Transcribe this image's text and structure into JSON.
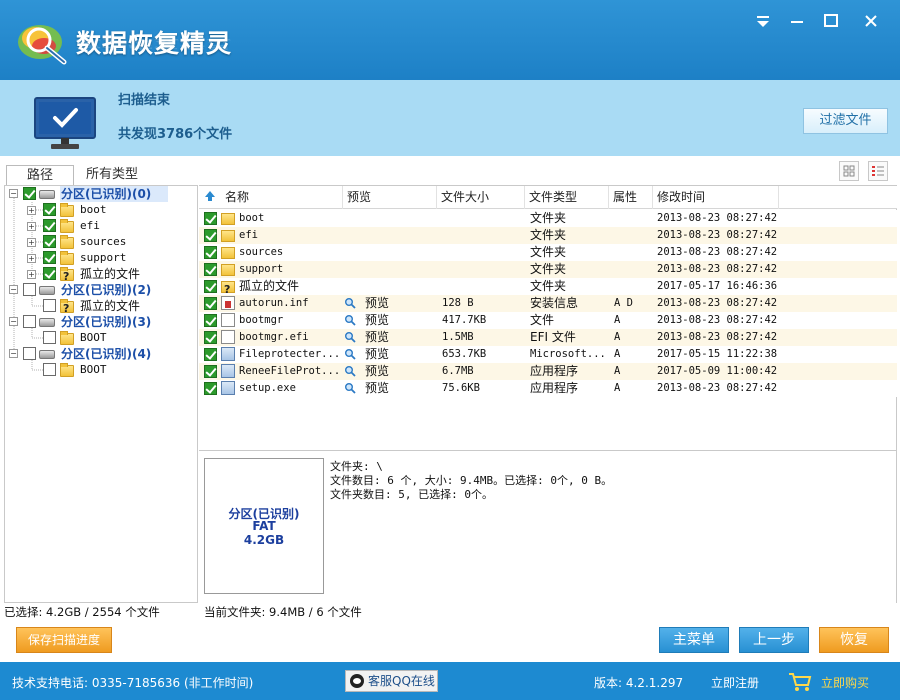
{
  "app": {
    "title": "数据恢复精灵"
  },
  "window_controls": {
    "menu": "▾",
    "minimize": "—",
    "maximize": "□",
    "close": "✕"
  },
  "scan": {
    "title": "扫描结束",
    "count_text": "共发现3786个文件"
  },
  "filter_button": "过滤文件",
  "tabs": {
    "path": "路径",
    "types": "所有类型"
  },
  "tree": [
    {
      "label": "分区(已识别)(0)",
      "type": "partition",
      "checked": true
    },
    {
      "label": "boot",
      "type": "folder",
      "checked": true
    },
    {
      "label": "efi",
      "type": "folder",
      "checked": true
    },
    {
      "label": "sources",
      "type": "folder",
      "checked": true
    },
    {
      "label": "support",
      "type": "folder",
      "checked": true
    },
    {
      "label": "孤立的文件",
      "type": "orphan",
      "checked": true
    },
    {
      "label": "分区(已识别)(2)",
      "type": "partition",
      "checked": false
    },
    {
      "label": "孤立的文件",
      "type": "orphan",
      "checked": false
    },
    {
      "label": "分区(已识别)(3)",
      "type": "partition",
      "checked": false
    },
    {
      "label": "BOOT",
      "type": "folder",
      "checked": false
    },
    {
      "label": "分区(已识别)(4)",
      "type": "partition",
      "checked": false
    },
    {
      "label": "BOOT",
      "type": "folder",
      "checked": false
    }
  ],
  "columns": {
    "name": "名称",
    "preview": "预览",
    "size": "文件大小",
    "type": "文件类型",
    "attr": "属性",
    "modified": "修改时间"
  },
  "files": [
    {
      "name": "boot",
      "icon": "folder-icon",
      "preview": "",
      "size": "",
      "type": "文件夹",
      "attr": "",
      "modified": "2013-08-23 08:27:42"
    },
    {
      "name": "efi",
      "icon": "folder-icon",
      "preview": "",
      "size": "",
      "type": "文件夹",
      "attr": "",
      "modified": "2013-08-23 08:27:42"
    },
    {
      "name": "sources",
      "icon": "folder-icon",
      "preview": "",
      "size": "",
      "type": "文件夹",
      "attr": "",
      "modified": "2013-08-23 08:27:42"
    },
    {
      "name": "support",
      "icon": "folder-icon",
      "preview": "",
      "size": "",
      "type": "文件夹",
      "attr": "",
      "modified": "2013-08-23 08:27:42"
    },
    {
      "name": "孤立的文件",
      "icon": "orphan-icon",
      "preview": "",
      "size": "",
      "type": "文件夹",
      "attr": "",
      "modified": "2017-05-17 16:46:36"
    },
    {
      "name": "autorun.inf",
      "icon": "inf-icon",
      "preview": "预览",
      "size": "128 B",
      "type": "安装信息",
      "attr": "A D",
      "modified": "2013-08-23 08:27:42"
    },
    {
      "name": "bootmgr",
      "icon": "file-icon",
      "preview": "预览",
      "size": "417.7KB",
      "type": "文件",
      "attr": "A",
      "modified": "2013-08-23 08:27:42"
    },
    {
      "name": "bootmgr.efi",
      "icon": "file-icon",
      "preview": "预览",
      "size": "1.5MB",
      "type": "EFI 文件",
      "attr": "A",
      "modified": "2013-08-23 08:27:42"
    },
    {
      "name": "Fileprotecter...",
      "icon": "exe-icon",
      "preview": "预览",
      "size": "653.7KB",
      "type": "Microsoft...",
      "attr": "A",
      "modified": "2017-05-15 11:22:38"
    },
    {
      "name": "ReneeFileProt...",
      "icon": "exe-icon",
      "preview": "预览",
      "size": "6.7MB",
      "type": "应用程序",
      "attr": "A",
      "modified": "2017-05-09 11:00:42"
    },
    {
      "name": "setup.exe",
      "icon": "exe-icon",
      "preview": "预览",
      "size": "75.6KB",
      "type": "应用程序",
      "attr": "A",
      "modified": "2013-08-23 08:27:42"
    }
  ],
  "partition_box": {
    "name": "分区(已识别)",
    "fs": "FAT",
    "size": "4.2GB"
  },
  "info": {
    "line1": "文件夹: \\",
    "line2": "文件数目: 6 个, 大小: 9.4MB。已选择: 0个, 0 B。",
    "line3": "文件夹数目: 5, 已选择: 0个。"
  },
  "status": {
    "selected": "已选择: 4.2GB / 2554 个文件",
    "current_folder": "当前文件夹: 9.4MB / 6 个文件"
  },
  "buttons": {
    "save_progress": "保存扫描进度",
    "main_menu": "主菜单",
    "back": "上一步",
    "recover": "恢复"
  },
  "footer": {
    "support": "技术支持电话: 0335-7185636 (非工作时间)",
    "qq": "客服QQ在线",
    "version": "版本: 4.2.1.297",
    "register": "立即注册",
    "buy": "立即购买"
  },
  "colors": {
    "titlebar": "#1d80c6",
    "status_band": "#a9dbf4",
    "accent_orange": "#ef9b20",
    "accent_blue": "#2890d3",
    "footer": "#1d8ad1",
    "buy_text": "#ffd84a"
  }
}
